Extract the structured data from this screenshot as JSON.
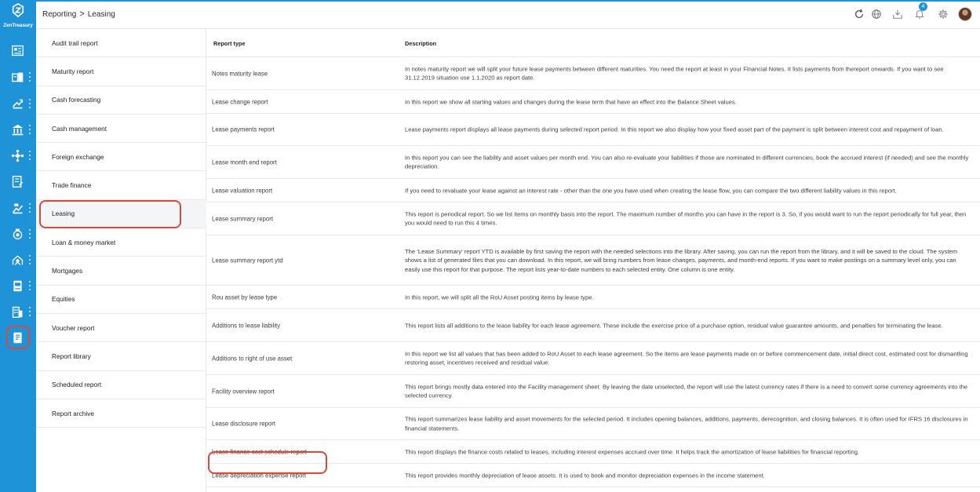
{
  "app": {
    "brand": "ZenTreasury"
  },
  "breadcrumb": {
    "parent": "Reporting",
    "separator": ">",
    "current": "Leasing"
  },
  "topbar": {
    "notification_count": "4"
  },
  "rail": {
    "icons": [
      "dashboard-icon",
      "accounts-icon",
      "payments-icon",
      "bank-icon",
      "network-icon",
      "documents-icon",
      "investments-icon",
      "cash-icon",
      "treasury-icon",
      "book-icon",
      "building-icon",
      "report-icon"
    ],
    "active": "report-icon"
  },
  "menu": {
    "items": [
      {
        "label": "Audit trail report"
      },
      {
        "label": "Maturity report"
      },
      {
        "label": "Cash forecasting"
      },
      {
        "label": "Cash management"
      },
      {
        "label": "Foreign exchange"
      },
      {
        "label": "Trade finance"
      },
      {
        "label": "Leasing"
      },
      {
        "label": "Loan & money market"
      },
      {
        "label": "Mortgages"
      },
      {
        "label": "Equities"
      },
      {
        "label": "Voucher report"
      },
      {
        "label": "Report library"
      },
      {
        "label": "Scheduled report"
      },
      {
        "label": "Report archive"
      }
    ],
    "active_index": 6
  },
  "table": {
    "headers": {
      "type": "Report type",
      "description": "Description"
    },
    "rows": [
      {
        "type": "Notes maturity lease",
        "description": "In notes maturity report we will split your future lease payments between different maturities. You need the report at least in your Financial Notes. It lists payments from thereport onwards. If you want to see 31.12.2019 situation use 1.1.2020 as report date."
      },
      {
        "type": "Lease change report",
        "description": "In this report we show all starting values and changes during the lease term that have an effect into the Balance Sheet values."
      },
      {
        "type": "Lease payments report",
        "description": "Lease payments report displays all lease payments during selected report period. In this report we also display how your fixed asset part of the payment is split between interest cost and repayment of loan."
      },
      {
        "type": "Lease month end report",
        "description": "In this report you can see the liability and asset values per month end. You can also re-evaluate your liabilities if those are nominated in different currencies, book the accrued interest (if needed) and see the monthly depreciation."
      },
      {
        "type": "Lease valuation report",
        "description": "If you need to revaluate your lease against an interest rate - other than the one you have used when creating the lease flow, you can compare the two different liability values in this report."
      },
      {
        "type": "Lease summary report",
        "description": "This report is periodical report. So we list items on monthly basis into the report. The maximum number of months you can have in the report is 3. So, if you would want to run the report periodically for full year, then you would need to run this 4 times."
      },
      {
        "type": "Lease summary report ytd",
        "description": "The ‘Lease Summary’ report YTD is available by first saving the report with the needed selections into the library. After saving, you can run the report from the library, and it will be saved to the cloud. The system shows a list of generated files that you can download. In this report, we will bring numbers from lease changes, payments, and month-end reports. If you want to make postings on a summary level only, you can easily use this report for that purpose. The report lists year-to-date numbers to each selected entity. One column is one entity."
      },
      {
        "type": "Rou asset by lease type",
        "description": "In this report, we will split all the RoU Asset posting items by lease type."
      },
      {
        "type": "Additions to lease liability",
        "description": "This report lists all additions to the lease liability for each lease agreement. These include the exercise price of a purchase option, residual value guarantee amounts, and penalties for terminating the lease."
      },
      {
        "type": "Additions to right of use asset",
        "description": "In this report we list all values that has been added to RoU Asset to each lease agreement. So the items are lease payments made on or before commencement date, initial direct cost, estimated cost for dismantling restoring asset, incentives received and residual value."
      },
      {
        "type": "Facility overview report",
        "description": "This report brings mostly data entered into the Facility management sheet. By leaving the date unselected, the report will use the latest currency rates if there is a need to convert some currency agreements into the selected currency."
      },
      {
        "type": "Lease disclosure report",
        "description": "This report summarizes lease liability and asset movements for the selected period. It includes opening balances, additions, payments, derecognition, and closing balances. It is often used for IFRS 16 disclosures in financial statements."
      },
      {
        "type": "Lease finance cost schedule report",
        "description": "This report displays the finance costs related to leases, including interest expenses accrued over time. It helps track the amortization of lease liabilities for financial reporting."
      },
      {
        "type": "Lease depreciation expense report",
        "description": "This report provides monthly depreciation of lease assets. It is used to book and monitor depreciation expenses in the income statement."
      }
    ]
  }
}
